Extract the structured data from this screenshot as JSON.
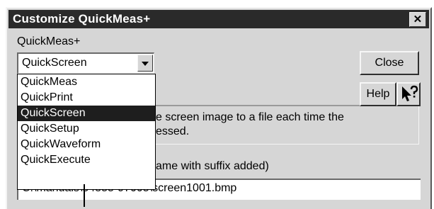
{
  "window": {
    "title": "Customize QuickMeas+",
    "close_glyph": "✕"
  },
  "form": {
    "group_label": "QuickMeas+",
    "combo_value": "QuickScreen",
    "dropdown_options": [
      "QuickMeas",
      "QuickPrint",
      "QuickScreen",
      "QuickSetup",
      "QuickWaveform",
      "QuickExecute"
    ],
    "selected_option": "QuickScreen",
    "description_line1": "e screen image to a file each time the",
    "description_line2": "essed.",
    "filename_label": "ame with suffix added)",
    "path_value": "C:\\manuals\\54855-97005\\screen1001.bmp"
  },
  "buttons": {
    "close_label": "Close",
    "help_label": "Help",
    "whats_this_icon": "help-pointer-icon"
  },
  "colors": {
    "titlebar": "#2a2a2a",
    "dialog_face": "#d6d6d6",
    "selection": "#1e1e1e"
  }
}
